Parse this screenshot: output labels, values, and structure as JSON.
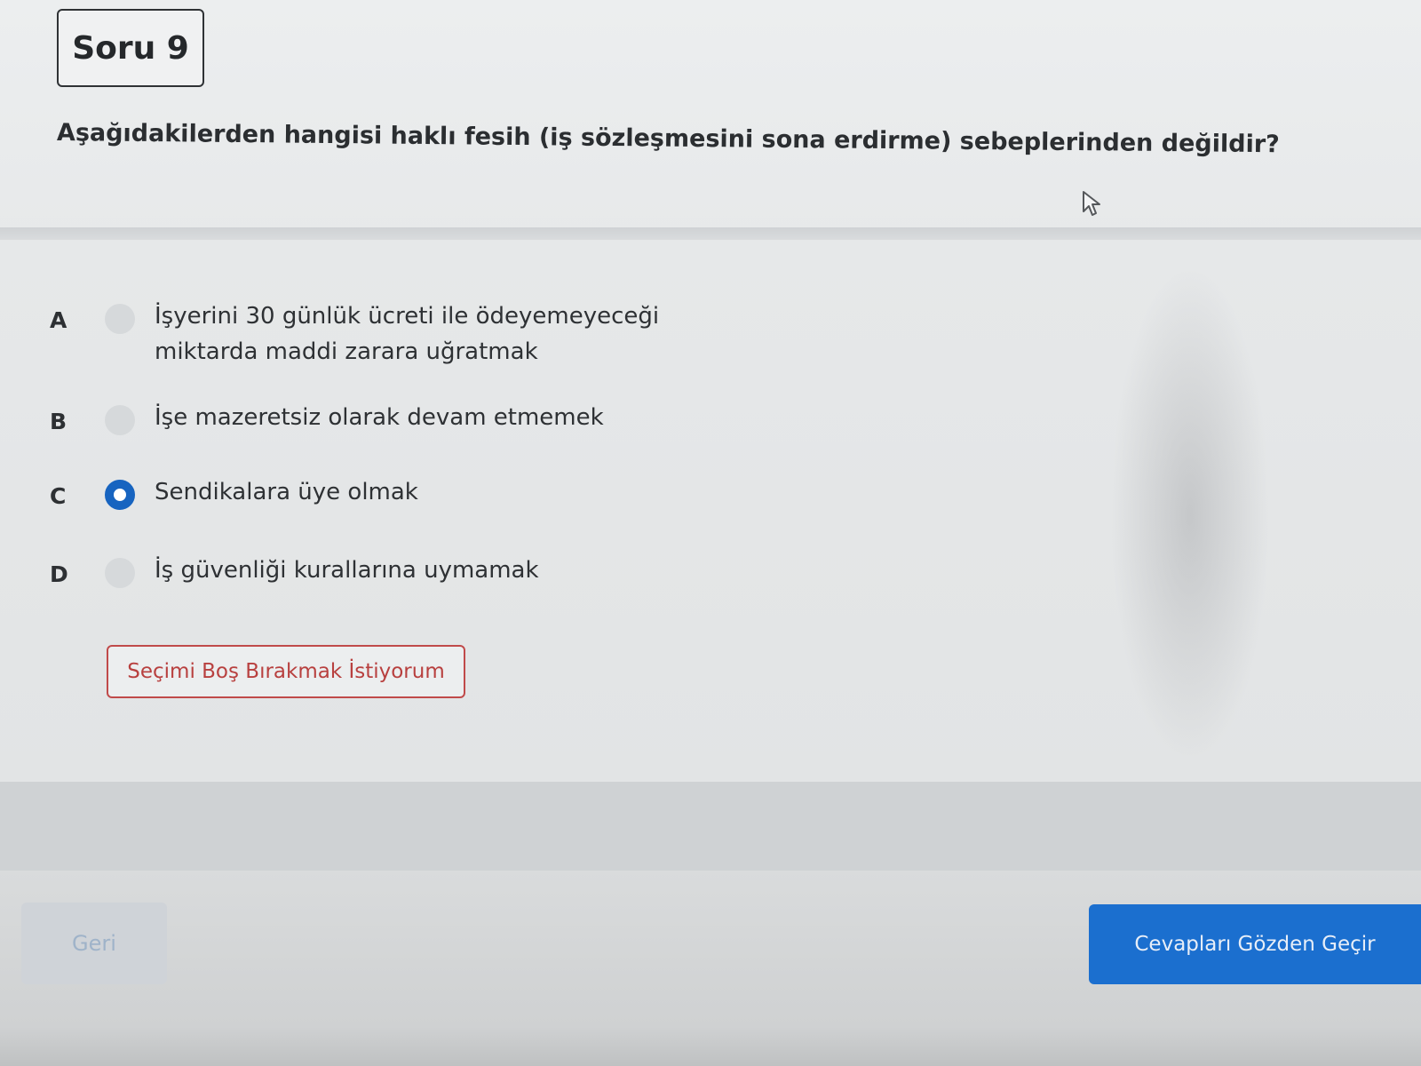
{
  "question": {
    "number_label": "Soru 9",
    "text": "Aşağıdakilerden hangisi haklı fesih (iş sözleşmesini sona erdirme) sebeplerinden değildir?"
  },
  "options": [
    {
      "letter": "A",
      "text": "İşyerini 30 günlük ücreti ile ödeyemeyeceği miktarda maddi zarara uğratmak",
      "selected": false
    },
    {
      "letter": "B",
      "text": "İşe mazeretsiz olarak devam etmemek",
      "selected": false
    },
    {
      "letter": "C",
      "text": "Sendikalara üye olmak",
      "selected": true
    },
    {
      "letter": "D",
      "text": "İş güvenliği kurallarına uymamak",
      "selected": false
    }
  ],
  "actions": {
    "skip_label": "Seçimi Boş Bırakmak İstiyorum",
    "back_label": "Geri",
    "review_label": "Cevapları Gözden Geçir"
  },
  "colors": {
    "accent": "#1b6fcf",
    "skip_border": "#c04a4a"
  }
}
